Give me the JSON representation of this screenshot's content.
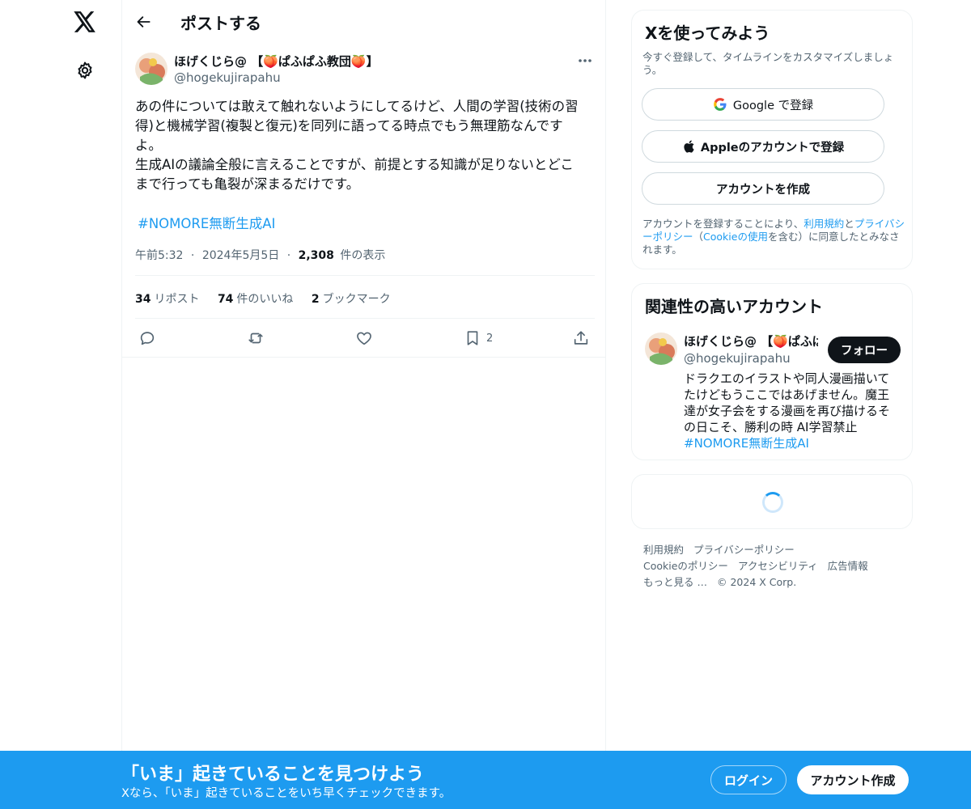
{
  "nav": {
    "logo_icon": "x-logo-icon",
    "settings_icon": "gear-icon"
  },
  "header": {
    "title": "ポストする",
    "back_icon": "back-arrow-icon"
  },
  "post": {
    "author_name": "ほげくじら@ 【🍑ぱふぱふ教団🍑】",
    "author_handle": "@hogekujirapahu",
    "body": "あの件については敢えて触れないようにしてるけど、人間の学習(技術の習\n得)と機械学習(複製と復元)を同列に語ってる時点でもう無理筋なんです\nよ。\n生成AIの議論全般に言えることですが、前提とする知識が足りないとどこ\nまで行っても亀裂が深まるだけです。",
    "hashtag": "#NOMORE無断生成AI",
    "time": "午前5:32",
    "date": "2024年5月5日",
    "views_count": "2,308",
    "views_label": "件の表示",
    "sep": "·",
    "stats": {
      "reposts_count": "34",
      "reposts_label": "リポスト",
      "likes_count": "74",
      "likes_label": "件のいいね",
      "bookmarks_count": "2",
      "bookmarks_label": "ブックマーク"
    },
    "actions": {
      "bookmark_count": "2"
    }
  },
  "signup_card": {
    "title": "Xを使ってみよう",
    "subtitle": "今すぐ登録して、タイムラインをカスタマイズしましょう。",
    "google_button": "Google で登録",
    "apple_button": "Appleのアカウントで登録",
    "create_button": "アカウントを作成",
    "legal_1": "アカウントを登録することにより、",
    "legal_terms": "利用規約",
    "legal_2": "と",
    "legal_privacy": "プライバシーポリシー",
    "legal_3": "（",
    "legal_cookie": "Cookieの使用",
    "legal_4": "を含む）に同意したとみなされます。"
  },
  "related_card": {
    "title": "関連性の高いアカウント",
    "name": "ほげくじら@ 【🍑ぱふぱふ教団🍑】",
    "handle": "@hogekujirapahu",
    "follow_button": "フォロー",
    "bio": "ドラクエのイラストや同人漫画描いてたけどもうここではあげません。魔王達が女子会をする漫画を再び描けるその日こそ、勝利の時 AI学習禁止",
    "bio_tag": "#NOMORE無断生成AI"
  },
  "footer": {
    "terms": "利用規約",
    "privacy": "プライバシーポリシー",
    "cookie": "Cookieのポリシー",
    "accessibility": "アクセシビリティ",
    "ads": "広告情報",
    "more": "もっと見る …",
    "copyright": "© 2024 X Corp."
  },
  "banner": {
    "title": "「いま」起きていることを見つけよう",
    "subtitle": "Xなら、「いま」起きていることをいち早くチェックできます。",
    "login_button": "ログイン",
    "signup_button": "アカウント作成"
  },
  "colors": {
    "accent": "#1d9bf0",
    "text": "#0f1419",
    "muted": "#536471",
    "border": "#eff3f4"
  }
}
